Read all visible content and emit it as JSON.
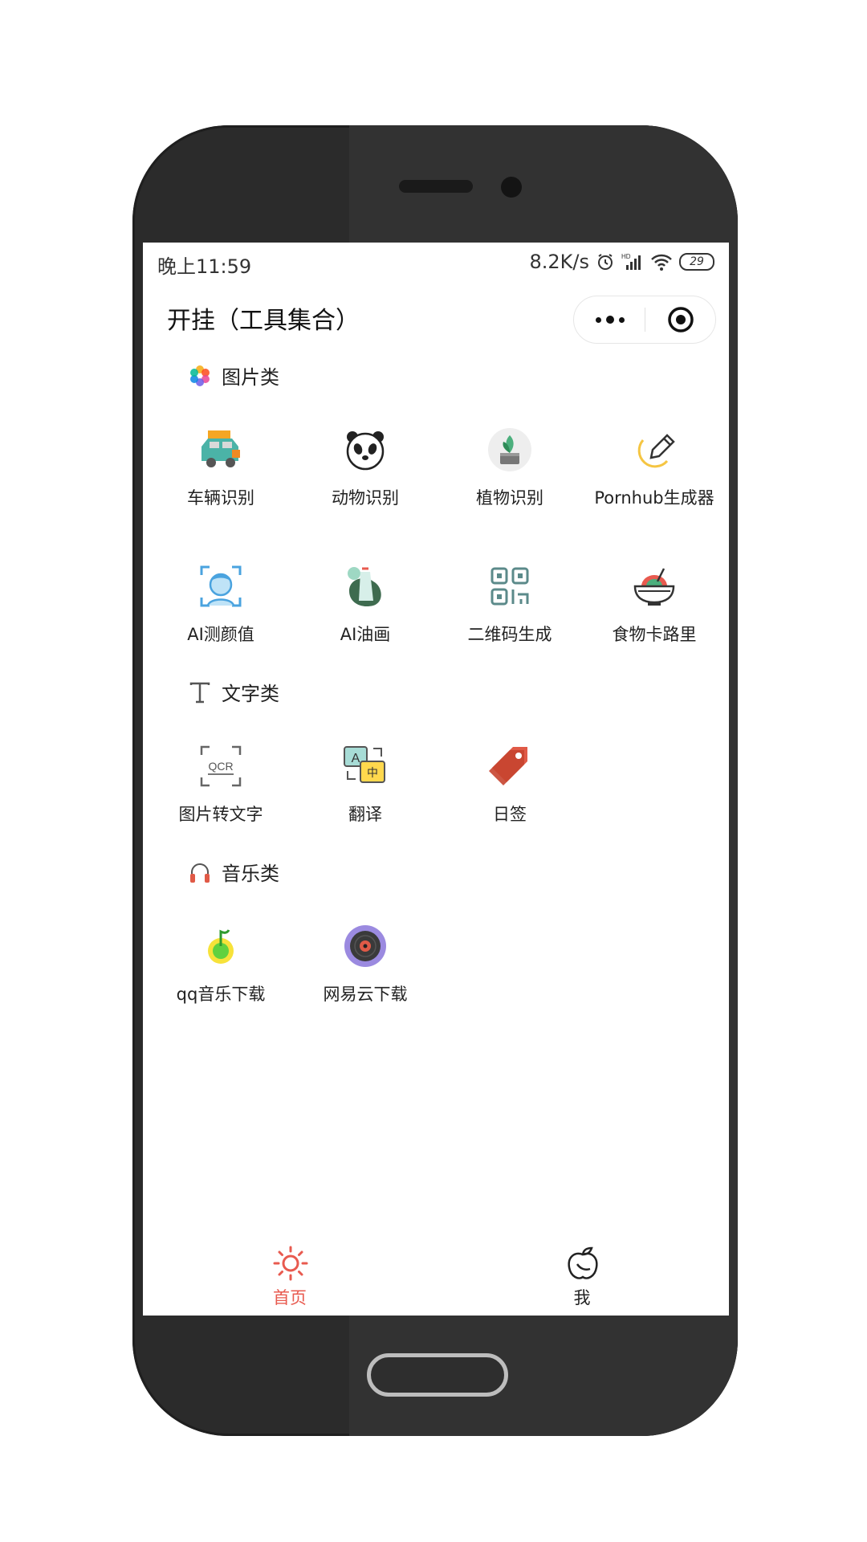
{
  "status": {
    "time": "晚上11:59",
    "speed": "8.2K/s",
    "battery": "29"
  },
  "title": "开挂（工具集合）",
  "sections": [
    {
      "label": "图片类",
      "icon": "flower-icon",
      "items": [
        {
          "label": "车辆识别",
          "icon": "car-icon"
        },
        {
          "label": "动物识别",
          "icon": "panda-icon"
        },
        {
          "label": "植物识别",
          "icon": "plant-icon"
        },
        {
          "label": "Pornhub生成器",
          "icon": "pen-icon"
        },
        {
          "label": "AI测颜值",
          "icon": "face-scan-icon"
        },
        {
          "label": "AI油画",
          "icon": "oil-painting-icon"
        },
        {
          "label": "二维码生成",
          "icon": "qrcode-icon"
        },
        {
          "label": "食物卡路里",
          "icon": "food-bowl-icon"
        }
      ]
    },
    {
      "label": "文字类",
      "icon": "text-icon",
      "items": [
        {
          "label": "图片转文字",
          "icon": "ocr-icon"
        },
        {
          "label": "翻译",
          "icon": "translate-icon"
        },
        {
          "label": "日签",
          "icon": "tag-icon"
        }
      ]
    },
    {
      "label": "音乐类",
      "icon": "headphones-icon",
      "items": [
        {
          "label": "qq音乐下载",
          "icon": "qq-music-icon"
        },
        {
          "label": "网易云下载",
          "icon": "netease-music-icon"
        }
      ]
    }
  ],
  "tabbar": [
    {
      "label": "首页",
      "icon": "sun-icon",
      "color": "#e85a4f"
    },
    {
      "label": "我",
      "icon": "fruit-icon",
      "color": "#222222"
    }
  ]
}
